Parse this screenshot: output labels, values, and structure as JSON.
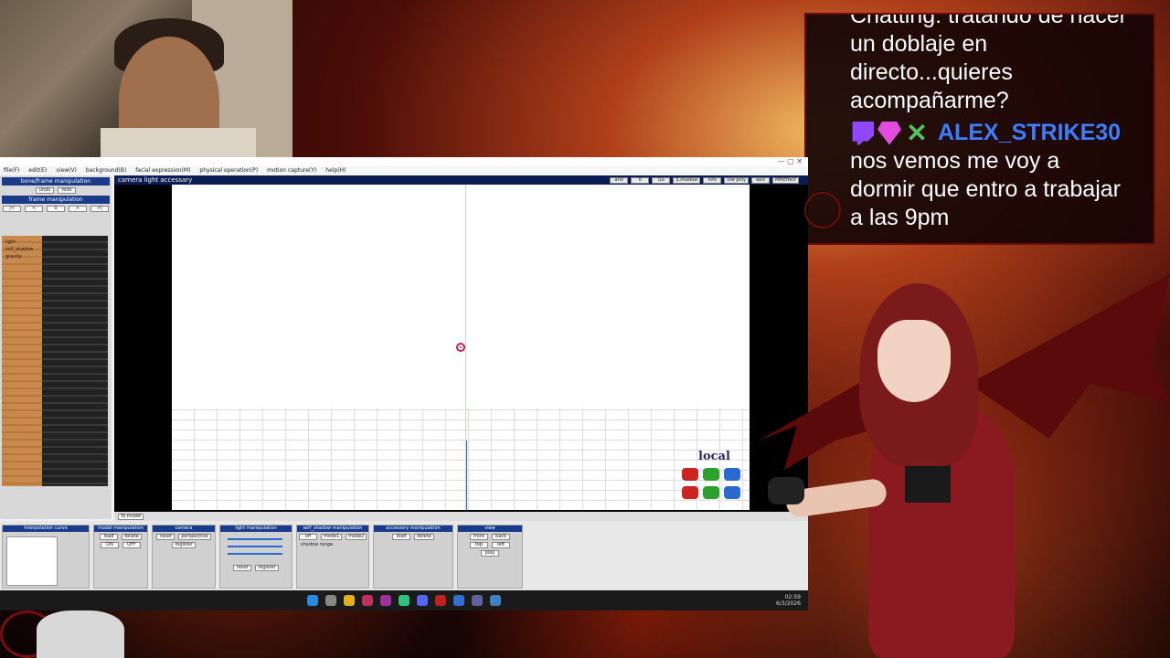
{
  "chat": {
    "top_message_partial": "Chatting: tratando de hacer",
    "top_message_lines": [
      "un doblaje en",
      "directo...quieres",
      "acompañarme?"
    ],
    "username": "ALEX_STRIKE30",
    "badges": [
      "twitch-icon",
      "gem-icon",
      "xbox-icon"
    ],
    "message_lines": [
      "nos vemos me voy a",
      "dormir que entro a trabajar",
      "a las 9pm"
    ]
  },
  "app": {
    "menu": [
      "file(F)",
      "edit(E)",
      "view(V)",
      "background(B)",
      "facial expression(M)",
      "physical operation(P)",
      "motion capture(Y)",
      "help(H)"
    ],
    "left_panel": {
      "header": "bone/frame manipulation",
      "undo": "undo",
      "redo": "redo",
      "subheader": "frame manipulation",
      "items": [
        "light",
        "self_shadow",
        "gravity"
      ]
    },
    "viewport": {
      "title": "camera light accessary",
      "axis_label": "local",
      "toolbar": [
        "anti",
        "0",
        "Go",
        "S.shadow",
        "info",
        "low poly",
        "axis"
      ],
      "badge": "MMEffect"
    },
    "bottom_strip": [
      "To model"
    ],
    "panels": {
      "interpolation": "Interpolation curve",
      "model": "model manipulation",
      "camera": "camera",
      "light": "light manipulation",
      "self_shadow": "self_shadow manipulation",
      "accessory": "accessory manipulation",
      "view": "view",
      "model_buttons": [
        "load",
        "delete"
      ],
      "camera_buttons": [
        "reset",
        "perspective"
      ],
      "light_buttons": [
        "reset",
        "register"
      ],
      "shadow_buttons": [
        "off",
        "mode1",
        "mode2"
      ],
      "shadow_range": "shadow range",
      "view_buttons": [
        "front",
        "back",
        "top",
        "left",
        "right",
        "bottom"
      ],
      "play_label": "play",
      "register": "register",
      "on_off": [
        "ON",
        "OFF"
      ]
    },
    "taskbar": {
      "time": "02:59",
      "date": "6/3/2026"
    }
  },
  "colors": {
    "chat_username": "#3d7dff",
    "panel_header": "#1a3b8a",
    "viewport_header": "#0a1c54",
    "light_marker": "#c02060"
  }
}
